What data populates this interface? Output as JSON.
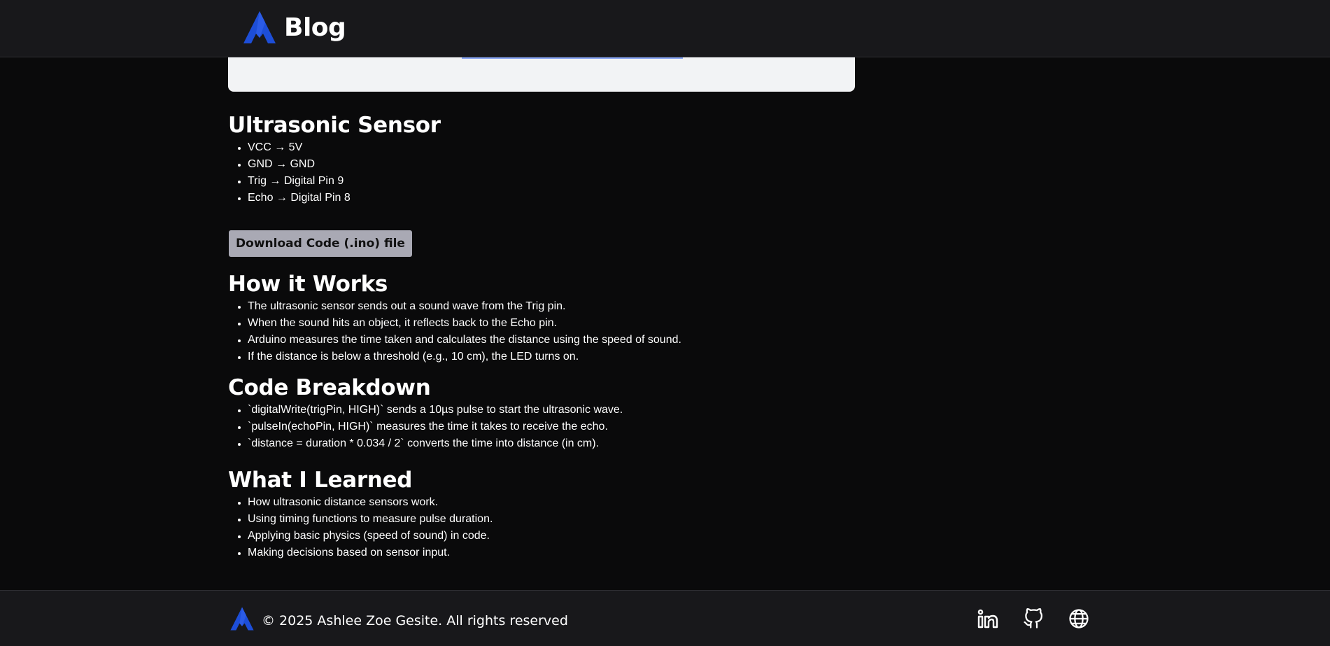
{
  "header": {
    "brand_title": "Blog"
  },
  "sections": {
    "sensor": {
      "heading": "Ultrasonic Sensor",
      "items": [
        "VCC → 5V",
        "GND → GND",
        "Trig → Digital Pin 9",
        "Echo → Digital Pin 8"
      ]
    },
    "download_label": "Download Code (.ino) file",
    "how": {
      "heading": "How it Works",
      "items": [
        "The ultrasonic sensor sends out a sound wave from the Trig pin.",
        "When the sound hits an object, it reflects back to the Echo pin.",
        "Arduino measures the time taken and calculates the distance using the speed of sound.",
        "If the distance is below a threshold (e.g., 10 cm), the LED turns on."
      ]
    },
    "code": {
      "heading": "Code Breakdown",
      "items": [
        "`digitalWrite(trigPin, HIGH)` sends a 10µs pulse to start the ultrasonic wave.",
        "`pulseIn(echoPin, HIGH)` measures the time it takes to receive the echo.",
        "`distance = duration * 0.034 / 2` converts the time into distance (in cm)."
      ]
    },
    "learned": {
      "heading": "What I Learned",
      "items": [
        "How ultrasonic distance sensors work.",
        "Using timing functions to measure pulse duration.",
        "Applying basic physics (speed of sound) in code.",
        "Making decisions based on sensor input."
      ]
    }
  },
  "footer": {
    "copyright": "© 2025 Ashlee Zoe Gesite. All rights reserved",
    "socials": [
      "linkedin-icon",
      "github-icon",
      "globe-icon"
    ]
  },
  "colors": {
    "logo_blue": "#1d4ed8",
    "header_bg": "#18181b",
    "page_bg": "#0a0a0b",
    "button_bg": "#a9a9b4"
  }
}
